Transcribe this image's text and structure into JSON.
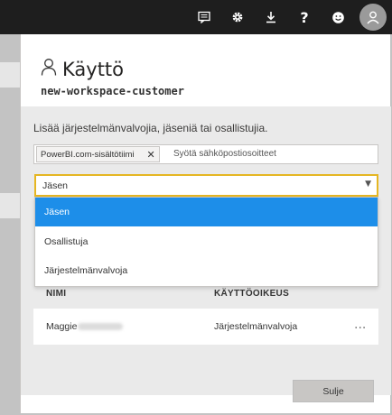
{
  "topbar": {
    "icons": [
      "notification-icon",
      "settings-icon",
      "download-icon",
      "help-icon",
      "feedback-icon",
      "account-icon"
    ],
    "help_label": "?",
    "background": "#1e1e1e"
  },
  "panel": {
    "title": "Käyttö",
    "workspace_name": "new-workspace-customer",
    "instruction": "Lisää järjestelmänvalvojia, jäseniä tai osallistujia.",
    "chip_label": "PowerBI.com-sisältötiimi",
    "chip_close": "✕",
    "email_placeholder": "Syötä sähköpostiosoitteet",
    "role_select": {
      "value": "Jäsen",
      "arrow": "▼",
      "options": [
        "Jäsen",
        "Osallistuja",
        "Järjestelmänvalvoja"
      ],
      "selected_index": 0
    },
    "table": {
      "columns": [
        "NIMI",
        "KÄYTTÖOIKEUS"
      ],
      "rows": [
        {
          "name": "Maggie",
          "access": "Järjestelmänvalvoja",
          "more": "..."
        }
      ]
    },
    "close_label": "Sulje"
  },
  "colors": {
    "accent_select_border": "#e5b622",
    "selected_option": "#1d8ee9",
    "panel_gray": "#eaeaea"
  }
}
